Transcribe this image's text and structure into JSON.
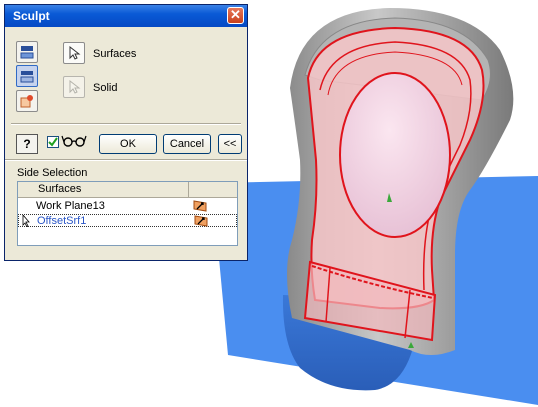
{
  "dialog": {
    "title": "Sculpt",
    "close_glyph": "✕",
    "side_buttons": [
      {
        "icon": "add-surface-icon",
        "pressed": false
      },
      {
        "icon": "remove-surface-icon",
        "pressed": true
      },
      {
        "icon": "body-solid-icon",
        "pressed": false
      }
    ],
    "options": {
      "surfaces_label": "Surfaces",
      "solid_label": "Solid"
    },
    "help_label": "?",
    "preview_checked": true,
    "ok_label": "OK",
    "cancel_label": "Cancel",
    "more_label": "<<",
    "side_selection_label": "Side Selection",
    "table": {
      "header": "Surfaces",
      "rows": [
        {
          "label": "Work Plane13",
          "selected": false
        },
        {
          "label": "OffsetSrf1",
          "selected": true
        }
      ]
    }
  },
  "colors": {
    "titlebar": "#0a5ad6",
    "dialog_bg": "#ece9d8",
    "plane_blue": "#4a8ef0",
    "surface_red": "#e0141c",
    "model_gray": "#a8a8a8"
  }
}
